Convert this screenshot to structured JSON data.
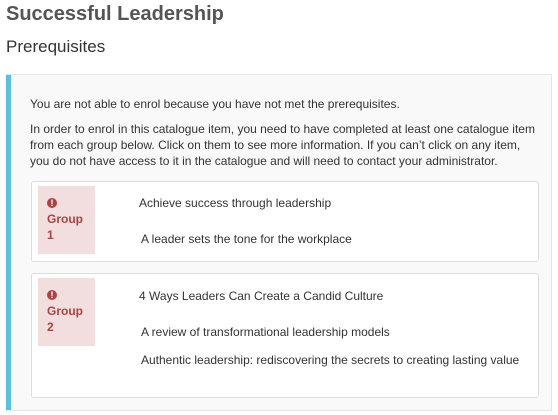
{
  "page": {
    "title": "Successful Leadership",
    "section_title": "Prerequisites"
  },
  "notice": {
    "message_1": "You are not able to enrol because you have not met the prerequisites.",
    "message_2": "In order to enrol in this catalogue item, you need to have completed at least one catalogue item from each group below. Click on them to see more information. If you can’t click on any item, you do not have access to it in the catalogue and will need to contact your administrator."
  },
  "groups": [
    {
      "label": "Group",
      "number": "1",
      "icon": "exclamation-circle-icon",
      "items": [
        "Achieve success through leadership",
        "A leader sets the tone for the workplace"
      ]
    },
    {
      "label": "Group",
      "number": "2",
      "icon": "exclamation-circle-icon",
      "items": [
        "4 Ways Leaders Can Create a Candid Culture",
        "A review of transformational leadership models",
        "Authentic leadership: rediscovering the secrets to creating lasting value"
      ]
    }
  ],
  "colors": {
    "accent": "#5bc0de",
    "group_tag_bg": "#f2dede",
    "group_tag_text": "#a94442"
  }
}
